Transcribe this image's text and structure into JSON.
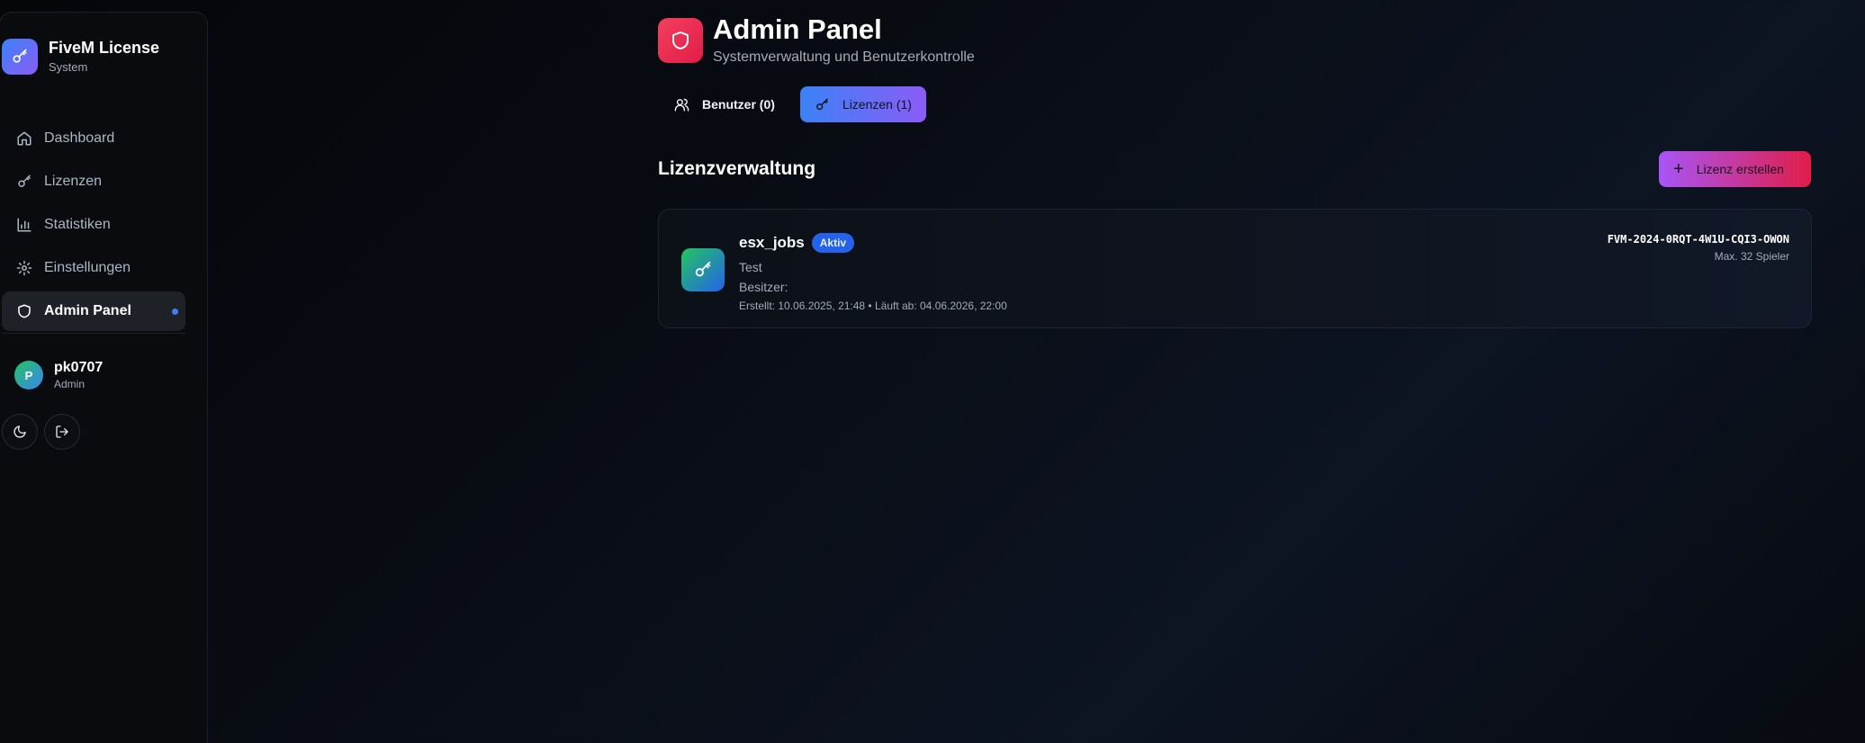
{
  "sidebar": {
    "brand_title": "FiveM License",
    "brand_subtitle": "System",
    "items": [
      {
        "label": "Dashboard",
        "icon": "home-icon"
      },
      {
        "label": "Lizenzen",
        "icon": "key-icon"
      },
      {
        "label": "Statistiken",
        "icon": "bar-chart-icon"
      },
      {
        "label": "Einstellungen",
        "icon": "gear-icon"
      },
      {
        "label": "Admin Panel",
        "icon": "shield-icon",
        "active": true
      }
    ],
    "user": {
      "initial": "P",
      "name": "pk0707",
      "role": "Admin"
    },
    "buttons": {
      "theme_icon": "moon-icon",
      "logout_icon": "logout-icon"
    }
  },
  "header": {
    "title": "Admin Panel",
    "subtitle": "Systemverwaltung und Benutzerkontrolle"
  },
  "tabs": [
    {
      "label": "Benutzer (0)",
      "icon": "users-icon"
    },
    {
      "label": "Lizenzen (1)",
      "icon": "key-icon",
      "active": true
    }
  ],
  "section": {
    "title": "Lizenzverwaltung",
    "create_label": "Lizenz erstellen"
  },
  "licenses": [
    {
      "name": "esx_jobs",
      "status": "Aktiv",
      "description": "Test",
      "owner": "Besitzer:",
      "dates": "Erstellt: 10.06.2025, 21:48 • Läuft ab: 04.06.2026, 22:00",
      "key": "FVM-2024-0RQT-4W1U-CQI3-OWON",
      "max_players": "Max. 32 Spieler"
    }
  ],
  "colors": {
    "accent_blue": "#3b82f6",
    "accent_purple": "#8b5cf6",
    "accent_red": "#e11d48",
    "status_active": "#2563eb"
  }
}
